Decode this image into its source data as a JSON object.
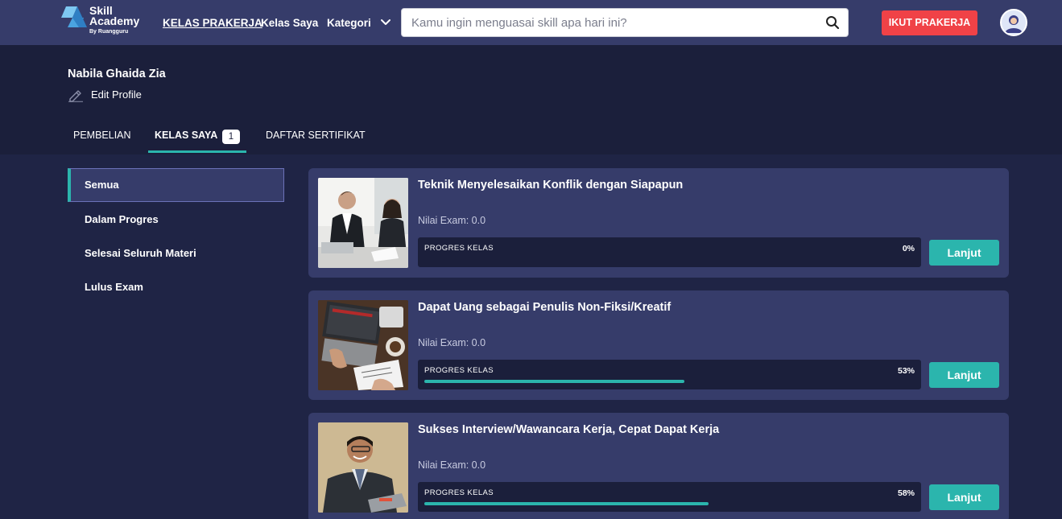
{
  "brand": {
    "name_line1": "Skill",
    "name_line2": "Academy",
    "byline": "By Ruangguru"
  },
  "nav": {
    "link1": "KELAS PRAKERJA",
    "link2": "Kelas Saya",
    "link3": "Kategori"
  },
  "search": {
    "placeholder": "Kamu ingin menguasai skill apa hari ini?",
    "value": ""
  },
  "cta": {
    "label": "IKUT PRAKERJA"
  },
  "profile": {
    "name": "Nabila Ghaida Zia",
    "edit_label": "Edit Profile"
  },
  "tabs": [
    {
      "label": "PEMBELIAN"
    },
    {
      "label": "KELAS SAYA",
      "badge": "1"
    },
    {
      "label": "DAFTAR SERTIFIKAT"
    }
  ],
  "filters": [
    {
      "label": "Semua"
    },
    {
      "label": "Dalam Progres"
    },
    {
      "label": "Selesai Seluruh Materi"
    },
    {
      "label": "Lulus Exam"
    }
  ],
  "courses": [
    {
      "title": "Teknik Menyelesaikan Konflik dengan Siapapun",
      "exam": "Nilai Exam: 0.0",
      "progress_label": "PROGRES KELAS",
      "progress_text": "0%",
      "progress": 0,
      "button": "Lanjut"
    },
    {
      "title": "Dapat Uang sebagai Penulis Non-Fiksi/Kreatif",
      "exam": "Nilai Exam: 0.0",
      "progress_label": "PROGRES KELAS",
      "progress_text": "53%",
      "progress": 53,
      "button": "Lanjut"
    },
    {
      "title": "Sukses Interview/Wawancara Kerja, Cepat Dapat Kerja",
      "exam": "Nilai Exam: 0.0",
      "progress_label": "PROGRES KELAS",
      "progress_text": "58%",
      "progress": 58,
      "button": "Lanjut"
    }
  ],
  "icons": [
    "logo-mark",
    "chevron-down-icon",
    "search-icon",
    "avatar-icon",
    "pencil-icon"
  ],
  "colors": {
    "nav_bg": "#363c6a",
    "page_bg": "#1f2445",
    "accent_teal": "#2bb5ad",
    "cta_red": "#f04247"
  }
}
